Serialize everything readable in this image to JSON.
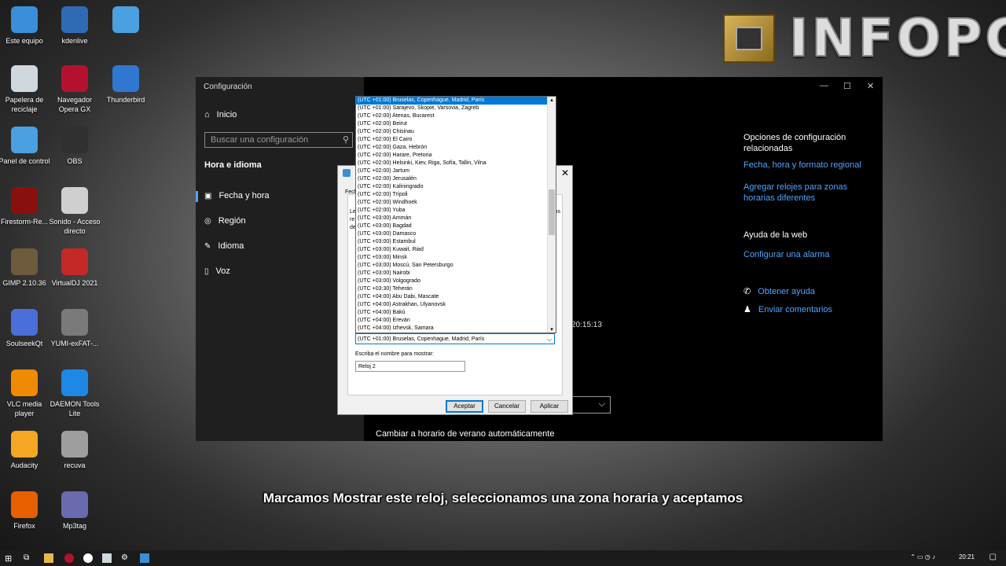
{
  "desktop_icons": [
    {
      "label": "Este equipo",
      "icon": "computer-icon",
      "color": "#3a8fd8"
    },
    {
      "label": "kdenlive",
      "icon": "kdenlive-icon",
      "color": "#2f6bb5"
    },
    {
      "label": "",
      "icon": "control-panel-icon",
      "color": "#4aa0e0"
    },
    {
      "label": "Papelera de reciclaje",
      "icon": "recycle-bin-icon",
      "color": "#cfd8dc"
    },
    {
      "label": "Navegador Opera GX",
      "icon": "opera-gx-icon",
      "color": "#b3122e"
    },
    {
      "label": "Thunderbird",
      "icon": "thunderbird-icon",
      "color": "#2f77d0"
    },
    {
      "label": "Panel de control",
      "icon": "control-panel-icon",
      "color": "#4aa0e0"
    },
    {
      "label": "OBS",
      "icon": "obs-icon",
      "color": "#303030"
    },
    {
      "label": "Firestorm-Re...",
      "icon": "firestorm-icon",
      "color": "#8a1010"
    },
    {
      "label": "Sonido - Acceso directo",
      "icon": "speaker-icon",
      "color": "#cfcfcf"
    },
    {
      "label": "GIMP 2.10.36",
      "icon": "gimp-icon",
      "color": "#6e5a3c"
    },
    {
      "label": "VirtualDJ 2021",
      "icon": "virtualdj-icon",
      "color": "#c62828"
    },
    {
      "label": "SoulseekQt",
      "icon": "soulseek-icon",
      "color": "#4a6fd8"
    },
    {
      "label": "YUMI-exFAT-...",
      "icon": "yumi-icon",
      "color": "#7a7a7a"
    },
    {
      "label": "VLC media player",
      "icon": "vlc-icon",
      "color": "#f08a00"
    },
    {
      "label": "DAEMON Tools Lite",
      "icon": "daemon-tools-icon",
      "color": "#1e88e5"
    },
    {
      "label": "Audacity",
      "icon": "audacity-icon",
      "color": "#f5a623"
    },
    {
      "label": "recuva",
      "icon": "recuva-icon",
      "color": "#9e9e9e"
    },
    {
      "label": "Firefox",
      "icon": "firefox-icon",
      "color": "#e66000"
    },
    {
      "label": "Mp3tag",
      "icon": "mp3tag-icon",
      "color": "#6a6ab0"
    }
  ],
  "logo": {
    "text": "INFOPC"
  },
  "settings": {
    "title": "Configuración",
    "home": "Inicio",
    "search_placeholder": "Buscar una configuración",
    "section": "Hora e idioma",
    "nav": [
      "Fecha y hora",
      "Región",
      "Idioma",
      "Voz"
    ],
    "related_heading": "Opciones de configuración relacionadas",
    "related_links": [
      "Fecha, hora y formato regional",
      "Agregar relojes para zonas horarias diferentes"
    ],
    "help_heading": "Ayuda de la web",
    "help_link": "Configurar una alarma",
    "get_help": "Obtener ayuda",
    "feedback": "Enviar comentarios",
    "time_readout": "20:15:13",
    "dst_toggle": "Cambiar a horario de verano automáticamente"
  },
  "dialog": {
    "tab_fragment": "Fech",
    "label_fragments": [
      "Le",
      "re",
      "de",
      "os"
    ],
    "timezone_selected": "(UTC +01:00) Bruselas, Copenhague, Madrid, París",
    "display_name_label": "Escriba el nombre para mostrar:",
    "display_name_value": "Reloj 2",
    "ok": "Aceptar",
    "cancel": "Cancelar",
    "apply": "Aplicar"
  },
  "timezones": [
    "(UTC +01:00) Bruselas, Copenhague, Madrid, París",
    "(UTC +01:00) Sarajevo, Skopie, Varsovia, Zagreb",
    "(UTC +02:00) Atenas, Bucarest",
    "(UTC +02:00) Beirut",
    "(UTC +02:00) Chisinau",
    "(UTC +02:00) El Cairo",
    "(UTC +02:00) Gaza, Hebrón",
    "(UTC +02:00) Harare, Pretoria",
    "(UTC +02:00) Helsinki, Kiev, Riga, Sofía, Tallin, Vilna",
    "(UTC +02:00) Jartum",
    "(UTC +02:00) Jerusalén",
    "(UTC +02:00) Kaliningrado",
    "(UTC +02:00) Trípoli",
    "(UTC +02:00) Windhoek",
    "(UTC +02:00) Yuba",
    "(UTC +03:00) Ammán",
    "(UTC +03:00) Bagdad",
    "(UTC +03:00) Damasco",
    "(UTC +03:00) Estambul",
    "(UTC +03:00) Kuwait, Riad",
    "(UTC +03:00) Minsk",
    "(UTC +03:00) Moscú, San Petersburgo",
    "(UTC +03:00) Nairobi",
    "(UTC +03:00) Volgogrado",
    "(UTC +03:30) Teherán",
    "(UTC +04:00) Abu Dabi, Mascate",
    "(UTC +04:00) Astrakhan, Ulyanovsk",
    "(UTC +04:00) Bakú",
    "(UTC +04:00) Ereván",
    "(UTC +04:00) Izhevsk, Samara"
  ],
  "caption": "Marcamos Mostrar este reloj, seleccionamos una zona horaria y aceptamos",
  "taskbar": {
    "clock": "20:21"
  }
}
